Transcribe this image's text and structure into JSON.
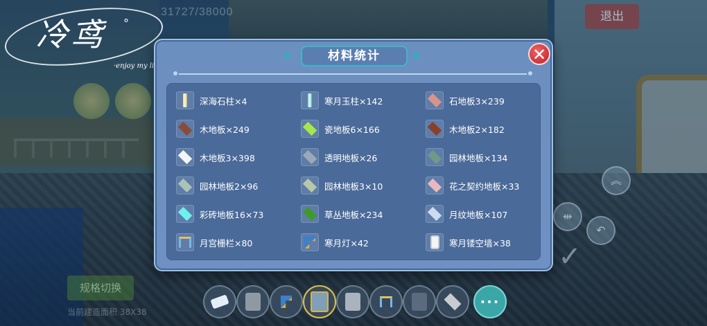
{
  "background": {
    "hud_count": "31727/38000",
    "exit_label": "退出",
    "hud_left_labels": [
      "",
      ""
    ],
    "switch_label": "规格切换",
    "area_text": "当前建造面积 38X38",
    "side_icons": [
      "double-chevron-up-icon",
      "mirror-flip-icon",
      "undo-icon"
    ],
    "confirm_icon": "checkmark-icon"
  },
  "watermark": {
    "script_text": "冷鸢",
    "degree": "°",
    "tagline": "·enjoy my life·"
  },
  "modal": {
    "title": "材料统计",
    "close_icon": "close-icon",
    "items": [
      {
        "label": "深海石柱×4",
        "icon": "pillar-gold-icon",
        "color": "#e8d9a0"
      },
      {
        "label": "寒月玉柱×142",
        "icon": "pillar-jade-icon",
        "color": "#7fd0c8"
      },
      {
        "label": "石地板3×239",
        "icon": "tile-icon",
        "color": "#d9948a"
      },
      {
        "label": "木地板×249",
        "icon": "tile-icon",
        "color": "#8a4b3c"
      },
      {
        "label": "瓷地板6×166",
        "icon": "tile-icon",
        "color": "#a6e84a"
      },
      {
        "label": "木地板2×182",
        "icon": "tile-icon",
        "color": "#8b3f2a"
      },
      {
        "label": "木地板3×398",
        "icon": "tile-icon",
        "color": "#f4f6f8"
      },
      {
        "label": "透明地板×26",
        "icon": "tile-icon",
        "color": "#9aa9b8"
      },
      {
        "label": "园林地板×134",
        "icon": "tile-icon",
        "color": "#6f9a88"
      },
      {
        "label": "园林地板2×96",
        "icon": "tile-icon",
        "color": "#a9c4b6"
      },
      {
        "label": "园林地板3×10",
        "icon": "tile-icon",
        "color": "#b6c8a8"
      },
      {
        "label": "花之契约地板×33",
        "icon": "tile-icon",
        "color": "#e8b8c0"
      },
      {
        "label": "彩砖地板16×73",
        "icon": "tile-icon",
        "color": "#6ef0f0"
      },
      {
        "label": "草丛地板×234",
        "icon": "tile-icon",
        "color": "#3f9a2c"
      },
      {
        "label": "月纹地板×107",
        "icon": "tile-icon",
        "color": "#c9dcf2"
      },
      {
        "label": "月宫栅栏×80",
        "icon": "fence-icon",
        "color": "#7ab7e8"
      },
      {
        "label": "寒月灯×42",
        "icon": "lamp-icon",
        "color": "#3e7fc8"
      },
      {
        "label": "寒月镂空墙×38",
        "icon": "wall-icon",
        "color": "#f2f4f6"
      }
    ]
  },
  "toolbar": {
    "slots": [
      {
        "icon": "eraser-icon",
        "color": "#e4eef6"
      },
      {
        "icon": "pillar-block-icon",
        "color": "#8f99a4"
      },
      {
        "icon": "lamp-icon",
        "color": "#3e7fc8"
      },
      {
        "icon": "ornate-block-icon",
        "color": "#7fa0b8"
      },
      {
        "icon": "pillar-block-icon",
        "color": "#a9b3bd"
      },
      {
        "icon": "fence-icon",
        "color": "#7ab7e8"
      },
      {
        "icon": "pillar-block-icon",
        "color": "#5b6b7d"
      },
      {
        "icon": "tile-icon",
        "color": "#c8ccd0"
      }
    ],
    "more_label": "···"
  }
}
